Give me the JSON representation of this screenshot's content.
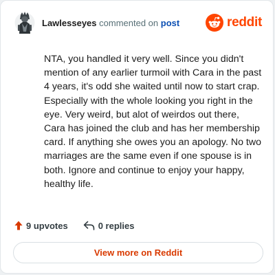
{
  "comment": {
    "author": "Lawlesseyes",
    "action_text": "commented on",
    "link_text": "post",
    "body": "NTA, you handled it very well. Since you didn't mention of any earlier turmoil with Cara in the past 4 years, it's odd she waited until now to start crap. Especially with the whole looking you right in the eye. Very weird, but alot of weirdos out there, Cara has joined the club and has her membership card. If anything she owes you an apology. No two marriages are the same even if one spouse is in both. Ignore and continue to enjoy your happy, healthy life.",
    "upvotes_label": "9 upvotes",
    "replies_label": "0 replies"
  },
  "brand": {
    "name": "reddit",
    "color": "#ff4500"
  },
  "footer": {
    "button_label": "View more on Reddit"
  },
  "icons": {
    "avatar": "avatar-figure",
    "logo": "reddit-snoo-icon",
    "upvote": "upvote-arrow-icon",
    "reply": "reply-arrow-icon"
  }
}
